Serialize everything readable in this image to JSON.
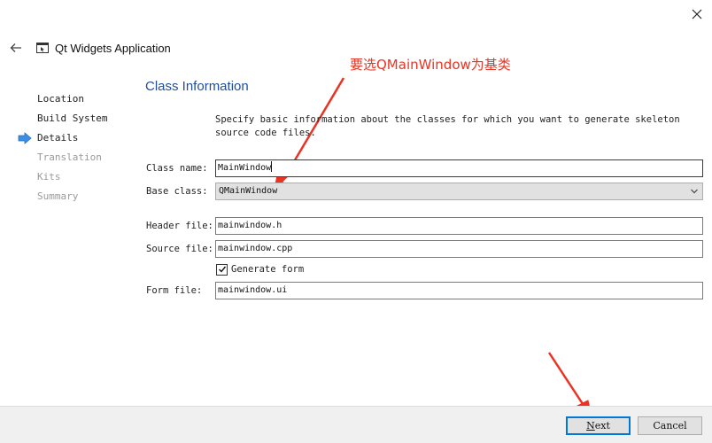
{
  "window": {
    "title": "Qt Widgets Application",
    "close_icon": "close-icon",
    "back_icon": "arrow-left-icon"
  },
  "annotation": {
    "text": "要选QMainWindow为基类",
    "color": "#ea3323"
  },
  "steps": [
    {
      "label": "Location",
      "state": "done"
    },
    {
      "label": "Build System",
      "state": "done"
    },
    {
      "label": "Details",
      "state": "current"
    },
    {
      "label": "Translation",
      "state": "pending"
    },
    {
      "label": "Kits",
      "state": "pending"
    },
    {
      "label": "Summary",
      "state": "pending"
    }
  ],
  "page": {
    "title": "Class Information",
    "description": "Specify basic information about the classes for which you want to generate skeleton source code files."
  },
  "form": {
    "class_name": {
      "label": "Class name:",
      "value": "MainWindow"
    },
    "base_class": {
      "label": "Base class:",
      "value": "QMainWindow"
    },
    "header_file": {
      "label": "Header file:",
      "value": "mainwindow.h"
    },
    "source_file": {
      "label": "Source file:",
      "value": "mainwindow.cpp"
    },
    "generate_form": {
      "label": "Generate form",
      "checked": true
    },
    "form_file": {
      "label": "Form file:",
      "value": "mainwindow.ui"
    }
  },
  "buttons": {
    "next_first": "N",
    "next_rest": "ext",
    "cancel": "Cancel"
  },
  "colors": {
    "accent": "#1f4e9e",
    "step_current_arrow": "#3c8fe6",
    "focus_border": "#0078d7",
    "annotation": "#ea3323"
  }
}
